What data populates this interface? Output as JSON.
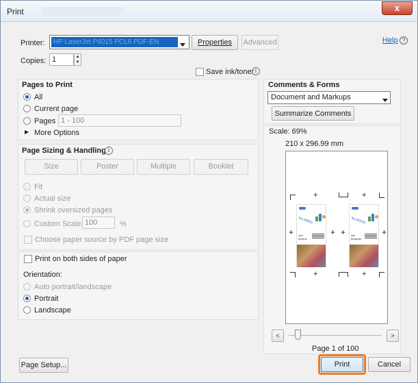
{
  "window": {
    "title": "Print",
    "close_glyph": "x"
  },
  "header": {
    "printer_label": "Printer:",
    "printer_value": "HP LaserJet P4015 PCL6 PDF-EN",
    "properties_label": "Properties",
    "advanced_label": "Advanced",
    "help_label": "Help",
    "copies_label": "Copies:",
    "copies_value": "1",
    "save_ink_label": "Save ink/toner"
  },
  "pages_to_print": {
    "title": "Pages to Print",
    "all_label": "All",
    "current_label": "Current page",
    "pages_label": "Pages",
    "pages_value": "1 - 100",
    "more_options_label": "More Options",
    "selected": "All"
  },
  "sizing": {
    "title": "Page Sizing & Handling",
    "tabs": [
      "Size",
      "Poster",
      "Multiple",
      "Booklet"
    ],
    "fit_label": "Fit",
    "actual_label": "Actual size",
    "shrink_label": "Shrink oversized pages",
    "custom_label": "Custom Scale:",
    "custom_value": "100",
    "custom_unit": "%",
    "paper_source_label": "Choose paper source by PDF page size",
    "both_sides_label": "Print on both sides of paper",
    "orientation_label": "Orientation:",
    "auto_label": "Auto portrait/landscape",
    "portrait_label": "Portrait",
    "landscape_label": "Landscape",
    "orientation_selected": "Portrait"
  },
  "comments": {
    "title": "Comments & Forms",
    "select_value": "Document and Markups",
    "summarize_label": "Summarize Comments"
  },
  "preview": {
    "scale_label": "Scale: 69%",
    "dimensions": "210 x 296.99 mm",
    "page_status": "Page 1 of 100",
    "card_left_text": "No.00001",
    "card_right_text": "No.00101",
    "card_left_name": "Lee\nAhrens",
    "card_right_name": "Val\nBeaudet"
  },
  "footer": {
    "page_setup_label": "Page Setup...",
    "print_label": "Print",
    "cancel_label": "Cancel"
  },
  "colors": {
    "accent": "#1e5bb8",
    "print_highlight": "#f07a22",
    "printer_select_bg": "#1565c0"
  }
}
